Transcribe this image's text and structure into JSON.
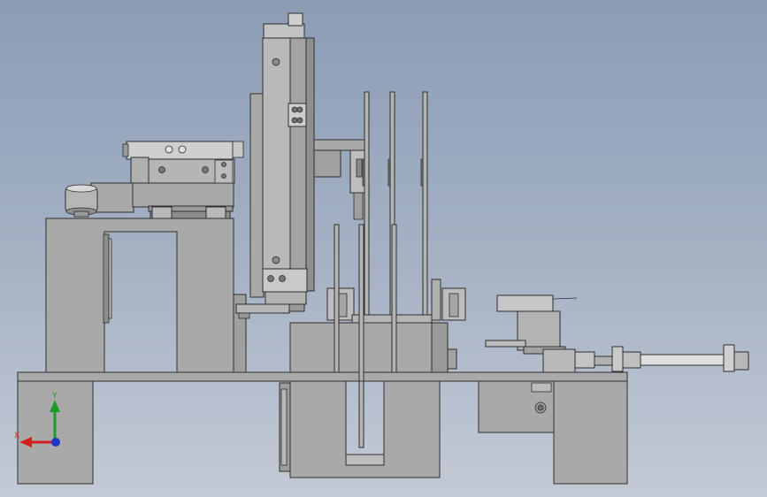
{
  "triad": {
    "y_label": "Y",
    "x_label": "X",
    "y_color": "#1f9a2c",
    "x_color": "#d41f1f",
    "z_color": "#2036c8"
  },
  "colors": {
    "part_fill": "#a9a9a9",
    "part_light": "#c7c7c7",
    "part_dark": "#7d7d7d",
    "rod": "#b4b4b4"
  }
}
